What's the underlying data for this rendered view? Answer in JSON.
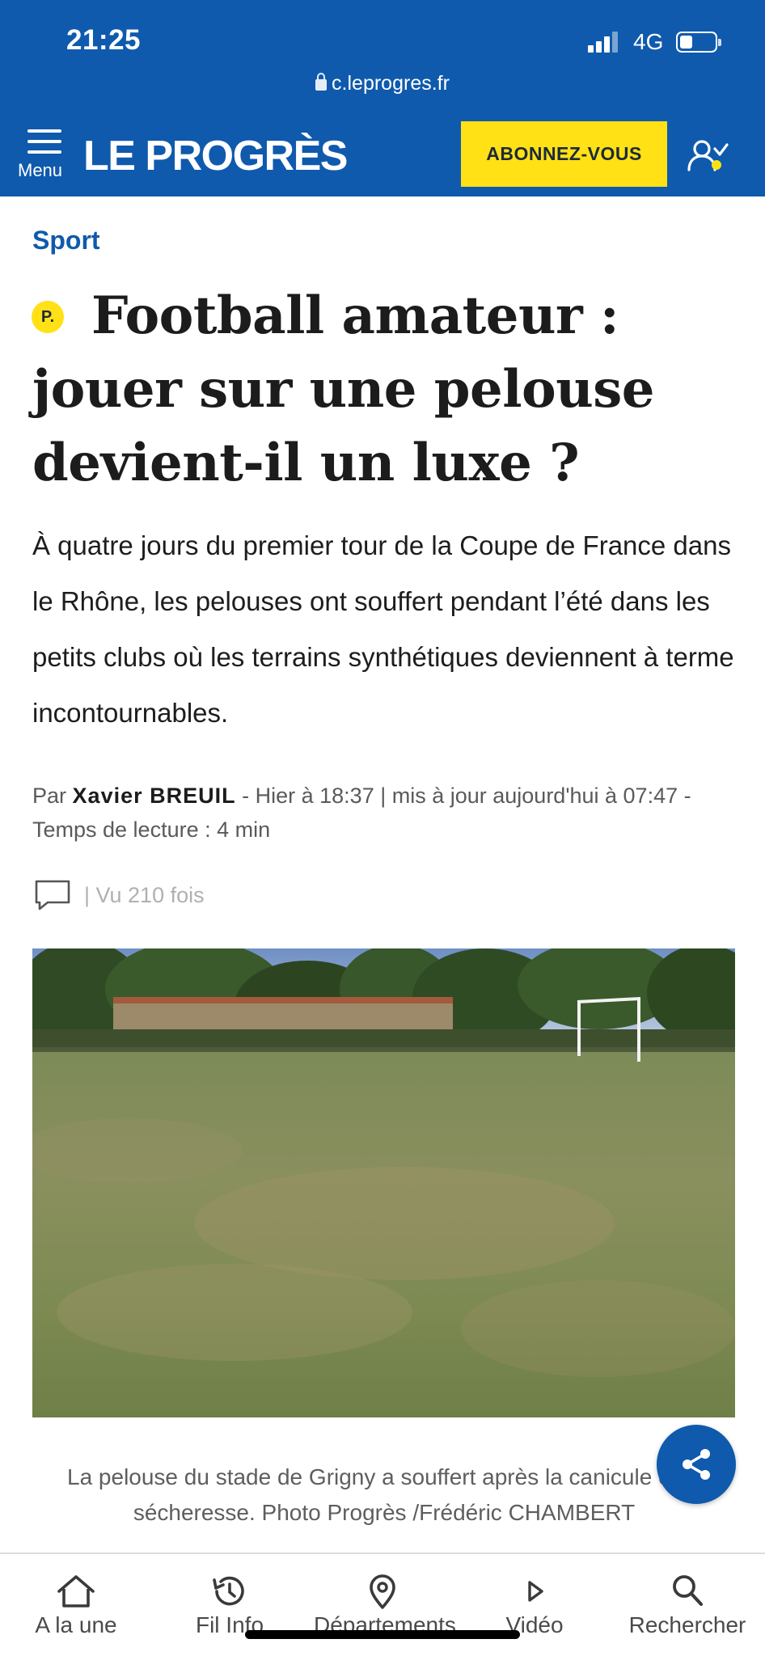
{
  "status_bar": {
    "time": "21:25",
    "network": "4G",
    "icons": [
      "signal-icon",
      "battery-icon"
    ]
  },
  "browser": {
    "url": "c.leprogres.fr",
    "icon": "lock-icon"
  },
  "site_header": {
    "menu_label": "Menu",
    "logo_text": "LE PROGRÈS",
    "subscribe_label": "ABONNEZ-VOUS",
    "icons": [
      "hamburger-menu-icon",
      "account-icon"
    ],
    "colors": {
      "header_bg": "#0f5aad",
      "subscribe_bg": "#ffe115",
      "subscribe_text": "#1d2a3b"
    }
  },
  "article": {
    "section": "Sport",
    "premium_badge": "P.",
    "headline": "Football amateur : jouer sur une pelouse devient-il un luxe ?",
    "chapo": "À quatre jours du premier tour de la Coupe de France dans le Rhône, les pelouses ont souffert pendant l’été dans les petits clubs où les terrains synthétiques deviennent à terme incontournables.",
    "byline": {
      "prefix": "Par",
      "author": "Xavier BREUIL",
      "meta": " - Hier à 18:37 | mis à jour aujourd'hui à 07:47 - Temps de lecture : 4 min"
    },
    "views": "| Vu 210 fois",
    "photo_caption": "La pelouse du stade de Grigny a souffert après la canicule et la sécheresse.  Photo Progrès /Frédéric CHAMBERT"
  },
  "share": {
    "icon": "share-icon"
  },
  "tab_bar": {
    "tabs": [
      {
        "label": "A la une",
        "icon": "home-icon"
      },
      {
        "label": "Fil Info",
        "icon": "history-clock-icon"
      },
      {
        "label": "Départements",
        "icon": "map-pin-icon"
      },
      {
        "label": "Vidéo",
        "icon": "play-icon"
      },
      {
        "label": "Rechercher",
        "icon": "search-icon"
      }
    ]
  }
}
